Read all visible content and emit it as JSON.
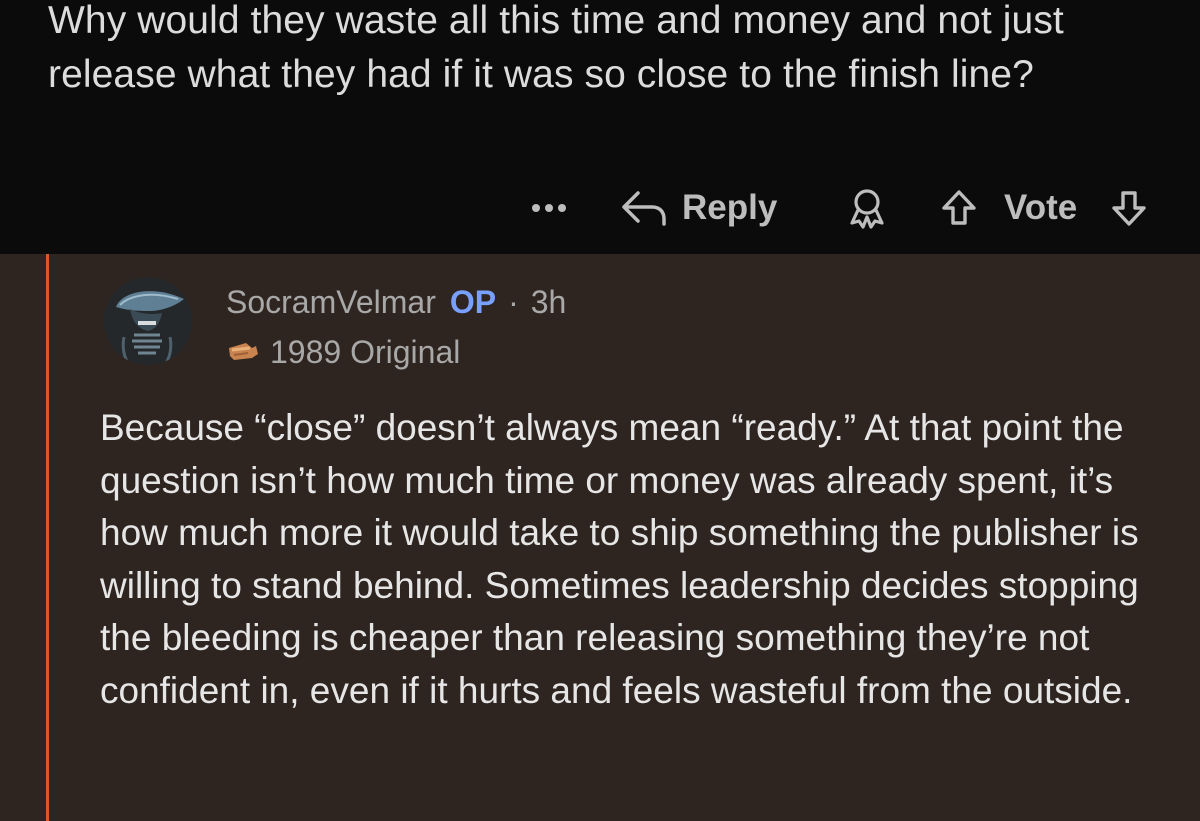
{
  "parent_comment": {
    "body": "Why would they waste all this time and money and not just release what they had if it was so close to the finish line?",
    "actions": {
      "more_icon": "more-dots-icon",
      "reply_label": "Reply",
      "reply_icon": "reply-arrow-icon",
      "award_icon": "award-icon",
      "upvote_icon": "upvote-arrow-icon",
      "vote_label": "Vote",
      "downvote_icon": "downvote-arrow-icon"
    }
  },
  "reply_comment": {
    "username": "SocramVelmar",
    "op_badge": "OP",
    "separator": "·",
    "timestamp": "3h",
    "flair_text": "1989 Original",
    "body": "Because “close” doesn’t always mean “ready.” At that point the question isn’t how much time or money was already spent, it’s how much more it would take to ship something the publisher is willing to stand behind. Sometimes leadership decides stopping the bleeding is cheaper than releasing something they’re not confident in, even if it hurts and feels wasteful from the outside."
  },
  "colors": {
    "parent_bg": "#0b0b0b",
    "reply_bg": "#2f2520",
    "thread_line": "#e0532f",
    "op_badge": "#7aa0ff",
    "text_primary": "#e6e6e6",
    "text_secondary": "#a8a8a8"
  }
}
